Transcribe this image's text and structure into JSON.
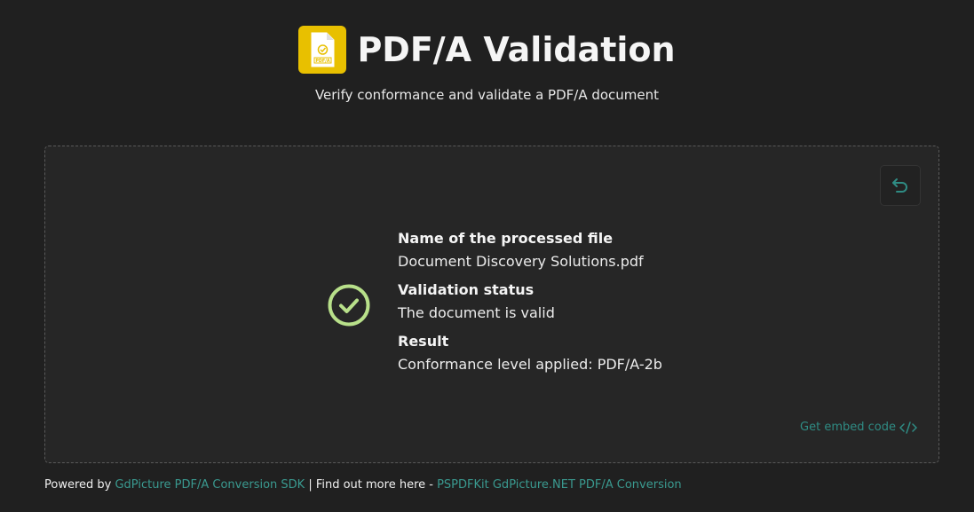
{
  "header": {
    "title": "PDF/A Validation",
    "subtitle": "Verify conformance and validate a PDF/A document",
    "logo_text": "PDF/A"
  },
  "result": {
    "file_label": "Name of the processed file",
    "file_value": "Document Discovery Solutions.pdf",
    "status_label": "Validation status",
    "status_value": "The document is valid",
    "result_label": "Result",
    "result_value": "Conformance level applied: PDF/A-2b"
  },
  "actions": {
    "embed_label": "Get embed code",
    "embed_icon": "code-icon",
    "reset_icon": "undo-icon"
  },
  "footer": {
    "powered_by": "Powered by ",
    "sdk_link": "GdPicture PDF/A Conversion SDK",
    "separator": " | Find out more here - ",
    "more_link": "PSPDFKit GdPicture.NET PDF/A Conversion"
  },
  "colors": {
    "background": "#202020",
    "panel": "#262626",
    "accent": "#2f8c84",
    "success": "#b8e08a",
    "logo": "#e8c000"
  }
}
